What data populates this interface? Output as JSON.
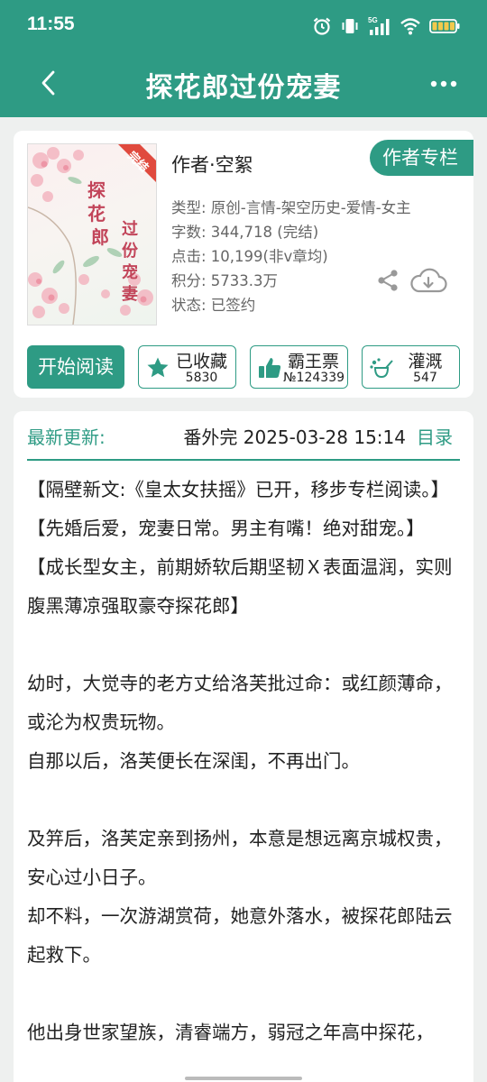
{
  "status_bar": {
    "time": "11:55",
    "network": "5G",
    "colors": {
      "battery": "#f2c94c"
    },
    "icons": [
      "alarm-icon",
      "vibrate-icon",
      "signal-icon",
      "wifi-icon",
      "battery-icon"
    ]
  },
  "nav": {
    "title": "探花郎过份宠妻",
    "icons": [
      "back-arrow-icon",
      "more-dots-icon"
    ]
  },
  "book": {
    "cover_badge": "完结",
    "author": "作者·空絮",
    "author_column": "作者专栏",
    "meta": [
      "类型: 原创-言情-架空历史-爱情-女主",
      "字数: 344,718 (完结)",
      "点击: 10,199(非v章均)",
      "积分: 5733.3万",
      "状态: 已签约"
    ],
    "start_reading": "开始阅读",
    "actions": {
      "collect": {
        "label": "已收藏",
        "count": "5830"
      },
      "ticket": {
        "label": "霸王票",
        "count": "№124339"
      },
      "irrigate": {
        "label": "灌溉",
        "count": "547"
      }
    }
  },
  "update": {
    "label": "最新更新:",
    "value": "番外完  2025-03-28 15:14",
    "catalog": "目录"
  },
  "intro": [
    "【隔壁新文:《皇太女扶摇》已开，移步专栏阅读。】",
    "【先婚后爱，宠妻日常。男主有嘴！绝对甜宠。】",
    "【成长型女主，前期娇软后期坚韧Ｘ表面温润，实则腹黑薄凉强取豪夺探花郎】",
    "",
    "幼时，大觉寺的老方丈给洛芙批过命：或红颜薄命，或沦为权贵玩物。",
    "自那以后，洛芙便长在深闺，不再出门。",
    "",
    "及笄后，洛芙定亲到扬州，本意是想远离京城权贵，安心过小日子。",
    "却不料，一次游湖赏荷，她意外落水，被探花郎陆云起救下。",
    "",
    "他出身世家望族，清睿端方，弱冠之年高中探花，"
  ],
  "colors": {
    "primary": "#2e9b84",
    "background": "#eef0ef",
    "text": "#222222",
    "meta_text": "#666666"
  }
}
